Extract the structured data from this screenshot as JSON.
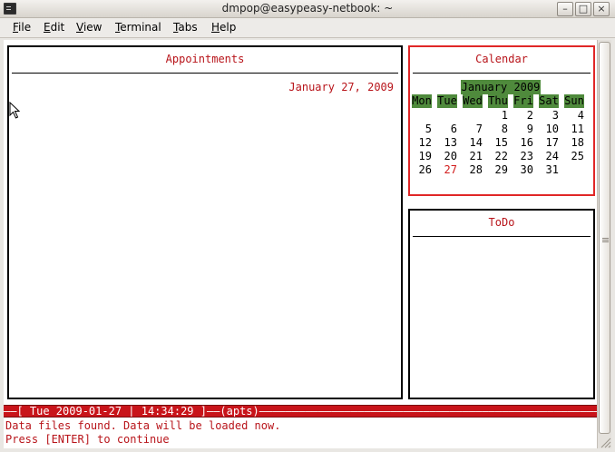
{
  "window": {
    "title": "dmpop@easypeasy-netbook: ~",
    "controls": {
      "minimize": "–",
      "maximize": "□",
      "close": "×"
    }
  },
  "menubar": {
    "items": [
      {
        "key": "F",
        "rest": "ile"
      },
      {
        "key": "E",
        "rest": "dit"
      },
      {
        "key": "V",
        "rest": "iew"
      },
      {
        "key": "T",
        "rest": "erminal"
      },
      {
        "key": "T",
        "rest": "abs"
      },
      {
        "key": "H",
        "rest": "elp"
      }
    ]
  },
  "appointments": {
    "title": "Appointments",
    "date": "January 27, 2009"
  },
  "calendar": {
    "title": "Calendar",
    "month": "January 2009",
    "weekdays": [
      "Mon",
      "Tue",
      "Wed",
      "Thu",
      "Fri",
      "Sat",
      "Sun"
    ],
    "weeks": [
      [
        "",
        "",
        "",
        "1",
        "2",
        "3",
        "4"
      ],
      [
        "5",
        "6",
        "7",
        "8",
        "9",
        "10",
        "11"
      ],
      [
        "12",
        "13",
        "14",
        "15",
        "16",
        "17",
        "18"
      ],
      [
        "19",
        "20",
        "21",
        "22",
        "23",
        "24",
        "25"
      ],
      [
        "26",
        "27",
        "28",
        "29",
        "30",
        "31",
        ""
      ]
    ],
    "today": "27"
  },
  "todo": {
    "title": "ToDo"
  },
  "status": {
    "line": "——[ Tue 2009-01-27 | 14:34:29 ]——(apts)————————————————————————————————————————————————————————————————",
    "message1": "Data files found. Data will be loaded now.",
    "message2": "Press [ENTER] to continue"
  },
  "colors": {
    "accent_red": "#b8141a",
    "calendar_green": "#4f8a3c",
    "status_bar": "#c8141a"
  }
}
